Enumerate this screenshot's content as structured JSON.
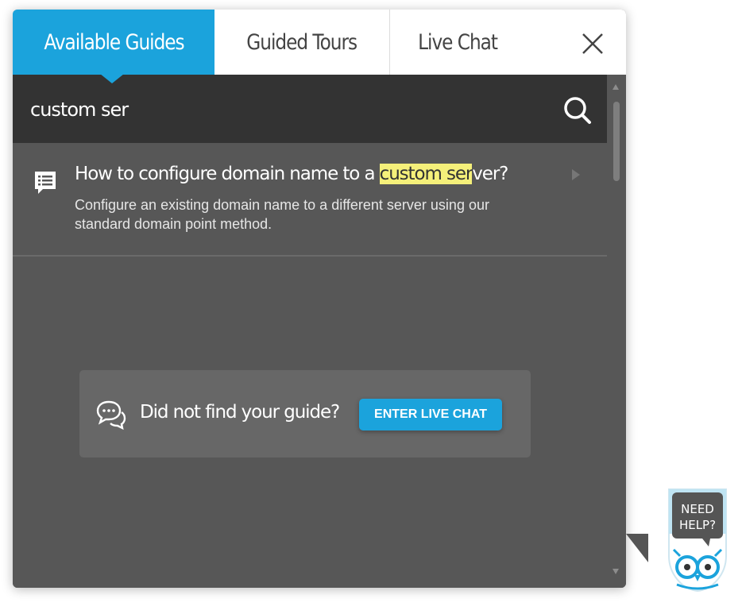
{
  "tabs": [
    {
      "label": "Available Guides",
      "active": true
    },
    {
      "label": "Guided Tours",
      "active": false
    },
    {
      "label": "Live Chat",
      "active": false
    }
  ],
  "close_icon": "close-icon",
  "search": {
    "value": "custom ser",
    "icon": "search-icon"
  },
  "results": [
    {
      "title_before": "How to configure domain name to a ",
      "title_highlight": "custom ser",
      "title_after": "ver?",
      "description": "Configure an existing domain name to a different server using our standard domain point method.",
      "icon": "guide-list-icon"
    }
  ],
  "not_found": {
    "text": "Did not find your guide?",
    "button_label": "ENTER LIVE CHAT",
    "icon": "chat-bubbles-icon"
  },
  "help_badge": {
    "line1": "NEED",
    "line2": "HELP?",
    "icon": "owl-icon"
  },
  "colors": {
    "accent": "#1ba3dc",
    "panel": "#575757",
    "search_bg": "#333333",
    "highlight": "#f5f07a"
  }
}
